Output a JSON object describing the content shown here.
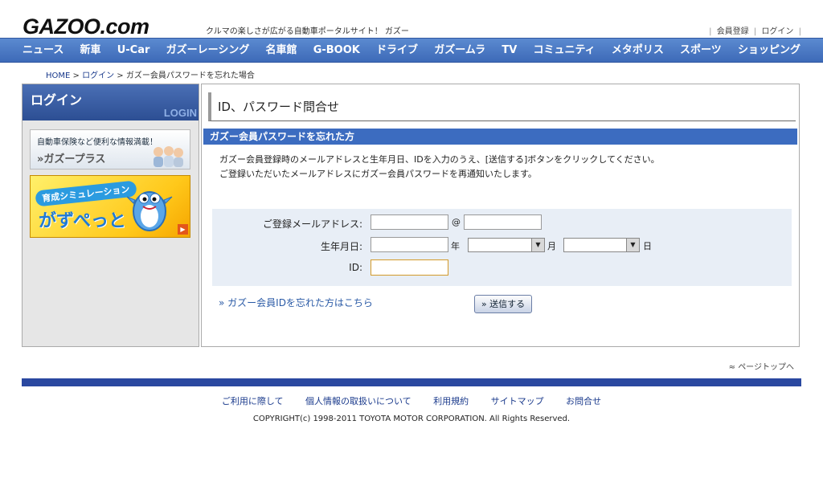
{
  "header": {
    "logo": "GAZOO.com",
    "tagline": "クルマの楽しさが広がる自動車ポータルサイト！ ガズー",
    "links": [
      "会員登録",
      "ログイン"
    ]
  },
  "nav": {
    "items": [
      "ニュース",
      "新車",
      "U-Car",
      "ガズーレーシング",
      "名車館",
      "G-BOOK",
      "ドライブ",
      "ガズームラ",
      "TV",
      "コミュニティ",
      "メタポリス",
      "スポーツ",
      "ショッピング"
    ]
  },
  "breadcrumb": {
    "home": "HOME",
    "login": "ログイン",
    "current": "ガズー会員パスワードを忘れた場合",
    "separator": ">"
  },
  "sidebar": {
    "title": "ログイン",
    "title_en": "LOGIN",
    "banner1": {
      "line1": "自動車保険など便利な情報満載！",
      "line2": "»ガズープラス"
    },
    "banner2": {
      "tag": "育成シミュレーション",
      "name": "がずぺっと"
    }
  },
  "main": {
    "title": "ID、パスワード問合せ",
    "section_title": "ガズー会員パスワードを忘れた方",
    "desc_line1": "ガズー会員登録時のメールアドレスと生年月日、IDを入力のうえ、[送信する]ボタンをクリックしてください。",
    "desc_line2": "ご登録いただいたメールアドレスにガズー会員パスワードを再通知いたします。",
    "form": {
      "email_label": "ご登録メールアドレス:",
      "at_symbol": "@",
      "birth_label": "生年月日:",
      "year_unit": "年",
      "month_unit": "月",
      "day_unit": "日",
      "id_label": "ID:",
      "email_local_value": "",
      "email_domain_value": "",
      "year_value": "",
      "month_value": "",
      "day_value": "",
      "id_value": ""
    },
    "forgot_id_link": "» ガズー会員IDを忘れた方はこちら",
    "submit_label": "» 送信する"
  },
  "footer": {
    "pagetop": "ページトップへ",
    "links": [
      "ご利用に際して",
      "個人情報の取扱いについて",
      "利用規約",
      "サイトマップ",
      "お問合せ"
    ],
    "copyright": "COPYRIGHT(c) 1998-2011 TOYOTA MOTOR CORPORATION. All Rights Reserved."
  },
  "icons": {
    "pagetop": "double-chevron-up-icon",
    "dropdown": "triangle-down-icon",
    "banner_arrow": "triangle-right-icon"
  }
}
